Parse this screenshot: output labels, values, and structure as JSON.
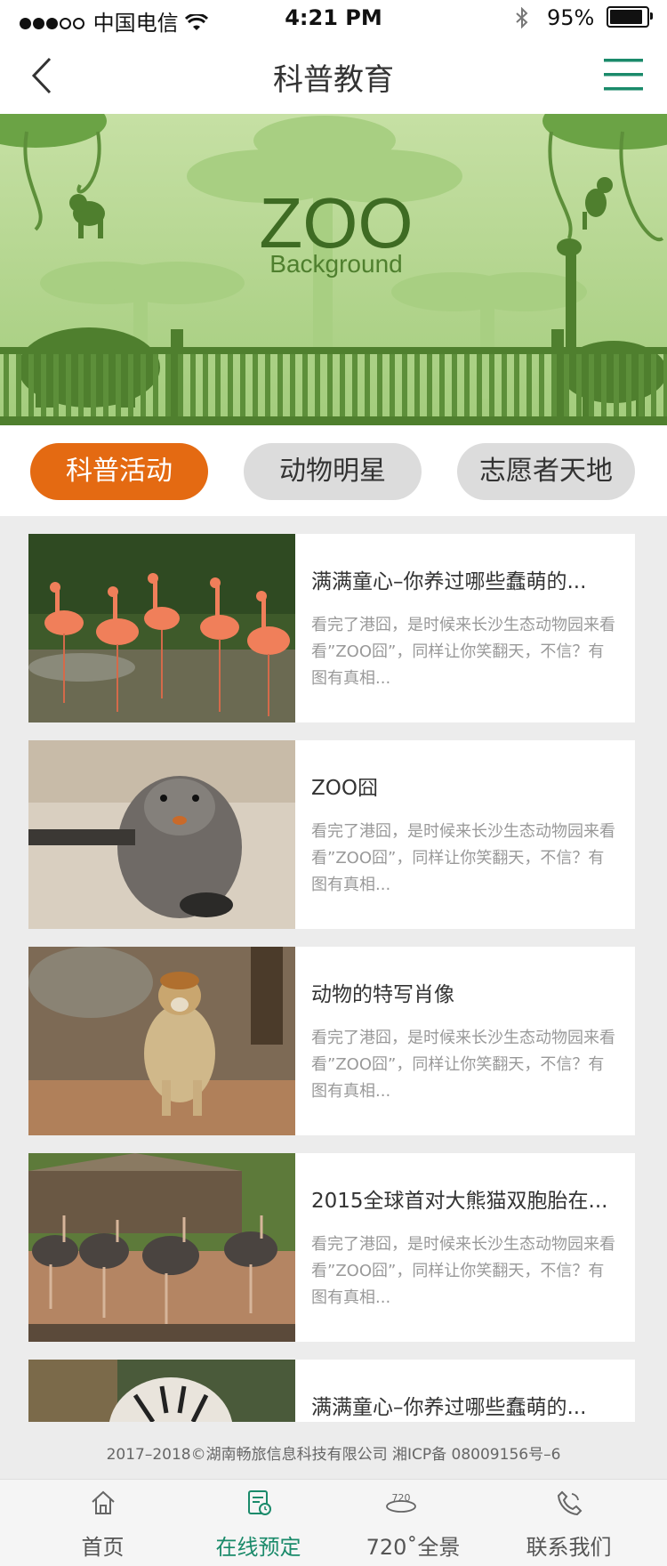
{
  "status_bar": {
    "carrier": "中国电信",
    "time": "4:21 PM",
    "battery": "95%",
    "battery_level": 0.95,
    "signal_bars": 3,
    "icons": [
      "signal-icon",
      "wifi-icon",
      "bluetooth-icon",
      "battery-icon"
    ]
  },
  "header": {
    "title": "科普教育",
    "back_icon": "chevron-left-icon",
    "menu_icon": "hamburger-menu-icon"
  },
  "banner": {
    "title": "ZOO",
    "subtitle": "Background"
  },
  "tabs": [
    {
      "label": "科普活动",
      "active": true
    },
    {
      "label": "动物明星",
      "active": false
    },
    {
      "label": "志愿者天地",
      "active": false
    }
  ],
  "articles": [
    {
      "title": "满满童心–你养过哪些蠢萌的...",
      "desc": "看完了港囧，是时候来长沙生态动物园来看看”ZOO囧”，同样让你笑翻天，不信？有图有真相...",
      "image": "flamingos-photo"
    },
    {
      "title": "ZOO囧",
      "desc": "看完了港囧，是时候来长沙生态动物园来看看”ZOO囧”，同样让你笑翻天，不信？有图有真相...",
      "image": "nutria-photo"
    },
    {
      "title": "动物的特写肖像",
      "desc": "看完了港囧，是时候来长沙生态动物园来看看”ZOO囧”，同样让你笑翻天，不信？有图有真相...",
      "image": "monkey-photo"
    },
    {
      "title": "2015全球首对大熊猫双胞胎在...",
      "desc": "看完了港囧，是时候来长沙生态动物园来看看”ZOO囧”，同样让你笑翻天，不信？有图有真相...",
      "image": "ostriches-photo"
    },
    {
      "title": "满满童心–你养过哪些蠢萌的...",
      "desc": "",
      "image": "tiger-photo"
    }
  ],
  "footer": {
    "copyright": "2017–2018©湖南畅旅信息科技有限公司  湘ICP备 08009156号–6"
  },
  "tabbar": [
    {
      "label": "首页",
      "icon": "home-icon",
      "active": false
    },
    {
      "label": "在线预定",
      "icon": "booking-icon",
      "active": true
    },
    {
      "label": "720˚全景",
      "icon": "panorama-720-icon",
      "active": false
    },
    {
      "label": "联系我们",
      "icon": "phone-icon",
      "active": false
    }
  ],
  "colors": {
    "accent": "#e46a12",
    "brand_green": "#1a8a6a",
    "banner_green": "#4f7f2e"
  }
}
